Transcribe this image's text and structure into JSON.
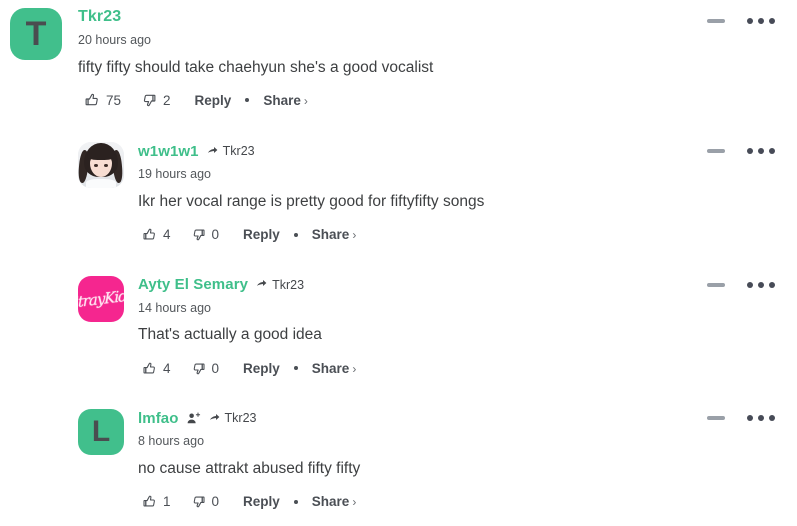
{
  "thread": {
    "comments": [
      {
        "id": "c1",
        "depth": "root",
        "avatar_type": "letter",
        "avatar_letter": "T",
        "avatar_color": "#41bf8c",
        "username": "Tkr23",
        "reply_to": null,
        "has_follow_badge": false,
        "timestamp": "20 hours ago",
        "text": "fifty fifty should take chaehyun she's a good vocalist",
        "upvotes": "75",
        "downvotes": "2",
        "reply_label": "Reply",
        "share_label": "Share",
        "share_chevron": "›",
        "collapse_icon": "minus-icon",
        "more_icon": "more-options-icon"
      },
      {
        "id": "c2",
        "depth": "reply",
        "avatar_type": "photo",
        "avatar_letter": "",
        "avatar_color": "#eef0f2",
        "username": "w1w1w1",
        "reply_to": "Tkr23",
        "has_follow_badge": false,
        "timestamp": "19 hours ago",
        "text": "Ikr her vocal range is pretty good for fiftyfifty songs",
        "upvotes": "4",
        "downvotes": "0",
        "reply_label": "Reply",
        "share_label": "Share",
        "share_chevron": "›",
        "collapse_icon": "minus-icon",
        "more_icon": "more-options-icon"
      },
      {
        "id": "c3",
        "depth": "reply",
        "avatar_type": "logo",
        "avatar_letter": "",
        "avatar_color": "#f5268f",
        "avatar_logo_text": "StrayKids",
        "username": "Ayty El Semary",
        "reply_to": "Tkr23",
        "has_follow_badge": false,
        "timestamp": "14 hours ago",
        "text": "That's actually a good idea",
        "upvotes": "4",
        "downvotes": "0",
        "reply_label": "Reply",
        "share_label": "Share",
        "share_chevron": "›",
        "collapse_icon": "minus-icon",
        "more_icon": "more-options-icon"
      },
      {
        "id": "c4",
        "depth": "reply",
        "avatar_type": "letter",
        "avatar_letter": "L",
        "avatar_color": "#41bf8c",
        "username": "lmfao",
        "reply_to": "Tkr23",
        "has_follow_badge": true,
        "timestamp": "8 hours ago",
        "text": "no cause attrakt abused fifty fifty",
        "upvotes": "1",
        "downvotes": "0",
        "reply_label": "Reply",
        "share_label": "Share",
        "share_chevron": "›",
        "collapse_icon": "minus-icon",
        "more_icon": "more-options-icon"
      }
    ]
  },
  "colors": {
    "username": "#3fbf8a",
    "avatar_green": "#41bf8c",
    "avatar_pink": "#f5268f",
    "body_text": "#3e4042",
    "muted_text": "#4b4f55",
    "background": "#ffffff"
  }
}
